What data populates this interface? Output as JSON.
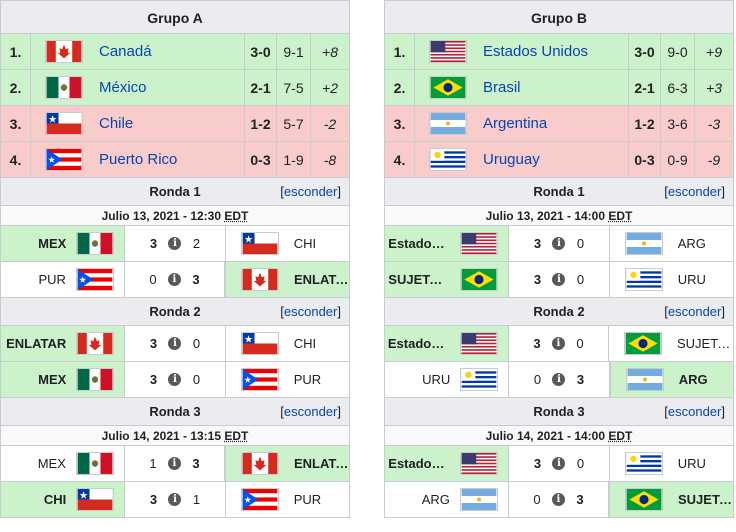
{
  "groups": [
    {
      "title": "Grupo A",
      "standings": [
        {
          "pos": "1.",
          "flag": "canada-flag",
          "name": "Canadá",
          "record": "3-0",
          "runs": "9-1",
          "diff": "+8",
          "status": "q"
        },
        {
          "pos": "2.",
          "flag": "mexico-flag",
          "name": "México",
          "record": "2-1",
          "runs": "7-5",
          "diff": "+2",
          "status": "q"
        },
        {
          "pos": "3.",
          "flag": "chile-flag",
          "name": "Chile",
          "record": "1-2",
          "runs": "5-7",
          "diff": "-2",
          "status": "e"
        },
        {
          "pos": "4.",
          "flag": "puerto-rico-flag",
          "name": "Puerto Rico",
          "record": "0-3",
          "runs": "1-9",
          "diff": "-8",
          "status": "e"
        }
      ],
      "rounds": [
        {
          "label": "Ronda 1",
          "hide": "esconder",
          "date": "Julio 13, 2021 - 12:30",
          "tz": "EDT",
          "games": [
            {
              "home": "MEX",
              "home_flag": "mexico-flag",
              "home_score": "3",
              "away_score": "2",
              "away": "CHI",
              "away_flag": "chile-flag",
              "winner": "home"
            },
            {
              "home": "PUR",
              "home_flag": "puerto-rico-flag",
              "home_score": "0",
              "away_score": "3",
              "away": "ENLATAR",
              "away_flag": "canada-flag",
              "winner": "away"
            }
          ]
        },
        {
          "label": "Ronda 2",
          "hide": "esconder",
          "date": "",
          "tz": "",
          "games": [
            {
              "home": "ENLATAR",
              "home_flag": "canada-flag",
              "home_score": "3",
              "away_score": "0",
              "away": "CHI",
              "away_flag": "chile-flag",
              "winner": "home"
            },
            {
              "home": "MEX",
              "home_flag": "mexico-flag",
              "home_score": "3",
              "away_score": "0",
              "away": "PUR",
              "away_flag": "puerto-rico-flag",
              "winner": "home"
            }
          ]
        },
        {
          "label": "Ronda 3",
          "hide": "esconder",
          "date": "",
          "tz": "",
          "games": [
            {
              "home": "MEX",
              "home_flag": "mexico-flag",
              "home_score": "1",
              "away_score": "3",
              "away": "ENLATAR",
              "away_flag": "canada-flag",
              "winner": "away",
              "date": "Julio 14, 2021 - 13:15",
              "tz": "EDT"
            },
            {
              "home": "CHI",
              "home_flag": "chile-flag",
              "home_score": "3",
              "away_score": "1",
              "away": "PUR",
              "away_flag": "puerto-rico-flag",
              "winner": "home"
            }
          ]
        }
      ]
    },
    {
      "title": "Grupo B",
      "standings": [
        {
          "pos": "1.",
          "flag": "usa-flag",
          "name": "Estados Unidos",
          "record": "3-0",
          "runs": "9-0",
          "diff": "+9",
          "status": "q"
        },
        {
          "pos": "2.",
          "flag": "brazil-flag",
          "name": "Brasil",
          "record": "2-1",
          "runs": "6-3",
          "diff": "+3",
          "status": "q"
        },
        {
          "pos": "3.",
          "flag": "argentina-flag",
          "name": "Argentina",
          "record": "1-2",
          "runs": "3-6",
          "diff": "-3",
          "status": "e"
        },
        {
          "pos": "4.",
          "flag": "uruguay-flag",
          "name": "Uruguay",
          "record": "0-3",
          "runs": "0-9",
          "diff": "-9",
          "status": "e"
        }
      ],
      "rounds": [
        {
          "label": "Ronda 1",
          "hide": "esconder",
          "date": "Julio 13, 2021 - 14:00",
          "tz": "EDT",
          "games": [
            {
              "home": "Estados Unidos",
              "home_flag": "usa-flag",
              "home_score": "3",
              "away_score": "0",
              "away": "ARG",
              "away_flag": "argentina-flag",
              "winner": "home"
            },
            {
              "home": "SUJETADOR",
              "home_flag": "brazil-flag",
              "home_score": "3",
              "away_score": "0",
              "away": "URU",
              "away_flag": "uruguay-flag",
              "winner": "home"
            }
          ]
        },
        {
          "label": "Ronda 2",
          "hide": "esconder",
          "date": "",
          "tz": "",
          "games": [
            {
              "home": "Estados Unidos",
              "home_flag": "usa-flag",
              "home_score": "3",
              "away_score": "0",
              "away": "SUJETADOR",
              "away_flag": "brazil-flag",
              "winner": "home"
            },
            {
              "home": "URU",
              "home_flag": "uruguay-flag",
              "home_score": "0",
              "away_score": "3",
              "away": "ARG",
              "away_flag": "argentina-flag",
              "winner": "away"
            }
          ]
        },
        {
          "label": "Ronda 3",
          "hide": "esconder",
          "date": "",
          "tz": "",
          "games": [
            {
              "home": "Estados Unidos",
              "home_flag": "usa-flag",
              "home_score": "3",
              "away_score": "0",
              "away": "URU",
              "away_flag": "uruguay-flag",
              "winner": "home",
              "date": "Julio 14, 2021 - 14:00",
              "tz": "EDT"
            },
            {
              "home": "ARG",
              "home_flag": "argentina-flag",
              "home_score": "0",
              "away_score": "3",
              "away": "SUJETADOR",
              "away_flag": "brazil-flag",
              "winner": "away"
            }
          ]
        }
      ]
    }
  ],
  "colors": {
    "qualified": "#ccf2cc",
    "eliminated": "#f9cccc",
    "link": "#0645ad",
    "header": "#eaecf0"
  }
}
